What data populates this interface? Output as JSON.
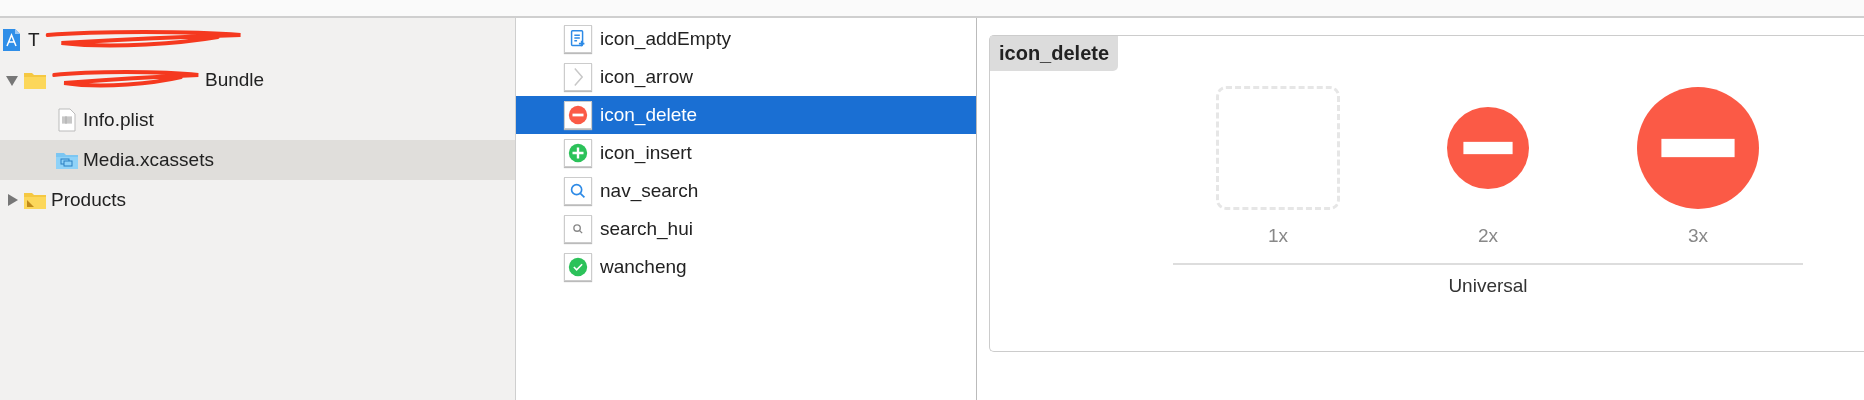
{
  "navigator": {
    "items": [
      {
        "label": "T",
        "kind": "project",
        "scribbled_after": true,
        "selected": false,
        "children": [
          {
            "label": "Bundle",
            "kind": "folder",
            "scribbled_before": true,
            "selected": false,
            "expanded": true,
            "children": [
              {
                "label": "Info.plist",
                "kind": "plist",
                "selected": false
              },
              {
                "label": "Media.xcassets",
                "kind": "assets",
                "selected": true
              }
            ]
          },
          {
            "label": "Products",
            "kind": "products",
            "selected": false,
            "expanded": false
          }
        ]
      }
    ]
  },
  "asset_list": {
    "items": [
      {
        "name": "icon_addEmpty",
        "kind": "doc-plus",
        "selected": false
      },
      {
        "name": "icon_arrow",
        "kind": "chevron",
        "selected": false
      },
      {
        "name": "icon_delete",
        "kind": "minus-circle",
        "selected": true
      },
      {
        "name": "icon_insert",
        "kind": "plus-circle",
        "selected": false
      },
      {
        "name": "nav_search",
        "kind": "search",
        "selected": false
      },
      {
        "name": "search_hui",
        "kind": "search-small",
        "selected": false
      },
      {
        "name": "wancheng",
        "kind": "check-circle",
        "selected": false
      }
    ]
  },
  "asset_detail": {
    "title": "icon_delete",
    "slots": [
      {
        "label": "1x",
        "kind": "empty"
      },
      {
        "label": "2x",
        "kind": "minus-circle"
      },
      {
        "label": "3x",
        "kind": "minus-circle"
      }
    ],
    "group_label": "Universal"
  }
}
